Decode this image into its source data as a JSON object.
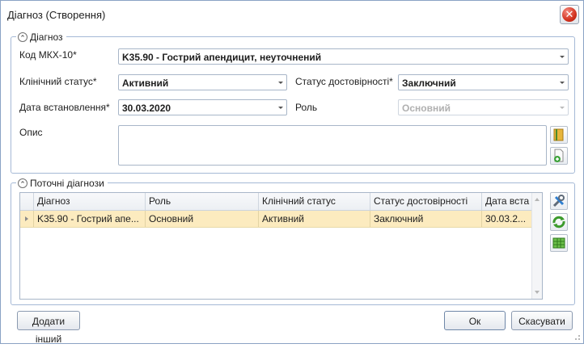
{
  "window": {
    "title": "Діагноз (Створення)"
  },
  "diagnosis_group": {
    "title": "Діагноз",
    "icd_label": "Код МКХ-10*",
    "icd_value": "K35.90 - Гострий апендицит, неуточнений",
    "clinical_status_label": "Клінічний статус*",
    "clinical_status_value": "Активний",
    "verification_status_label": "Статус достовірності*",
    "verification_status_value": "Заключний",
    "date_label": "Дата встановлення*",
    "date_value": "30.03.2020",
    "role_label": "Роль",
    "role_value": "Основний",
    "description_label": "Опис",
    "description_value": ""
  },
  "current_group": {
    "title": "Поточні діагнози",
    "columns": [
      "Діагноз",
      "Роль",
      "Клінічний статус",
      "Статус достовірності",
      "Дата вста"
    ],
    "rows": [
      {
        "diagnosis": "K35.90 - Гострий апе...",
        "role": "Основний",
        "clinical_status": "Активний",
        "verification_status": "Заключний",
        "date": "30.03.2..."
      }
    ]
  },
  "buttons": {
    "add_other": "Додати інший",
    "ok": "Ок",
    "cancel": "Скасувати"
  },
  "icons": {
    "close": "close-icon",
    "collapse": "chevron-up-icon",
    "dictionary": "book-icon",
    "add_document": "add-document-icon",
    "edit": "tools-icon",
    "refresh": "refresh-icon",
    "table": "table-icon"
  }
}
